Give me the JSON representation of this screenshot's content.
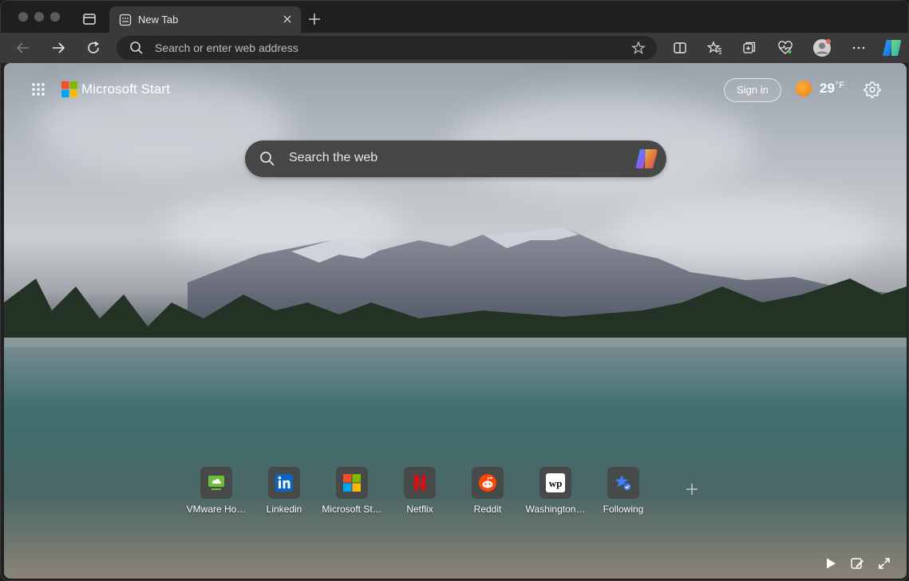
{
  "tab": {
    "title": "New Tab"
  },
  "omnibox": {
    "placeholder": "Search or enter web address"
  },
  "brand": {
    "name": "Microsoft Start"
  },
  "header": {
    "signin_label": "Sign in",
    "temperature": "29",
    "temp_unit": "°F"
  },
  "search": {
    "placeholder": "Search the web"
  },
  "tiles": [
    {
      "label": "VMware Ho…",
      "icon": "vmware-icon"
    },
    {
      "label": "Linkedin",
      "icon": "linkedin-icon"
    },
    {
      "label": "Microsoft St…",
      "icon": "microsoft-store-icon"
    },
    {
      "label": "Netflix",
      "icon": "netflix-icon"
    },
    {
      "label": "Reddit",
      "icon": "reddit-icon"
    },
    {
      "label": "Washington…",
      "icon": "washington-post-icon"
    },
    {
      "label": "Following",
      "icon": "following-icon"
    }
  ],
  "colors": {
    "accent_weather": "#f08a14",
    "toolbar": "#3a3a3a",
    "tabstrip": "#1f1f1f"
  }
}
